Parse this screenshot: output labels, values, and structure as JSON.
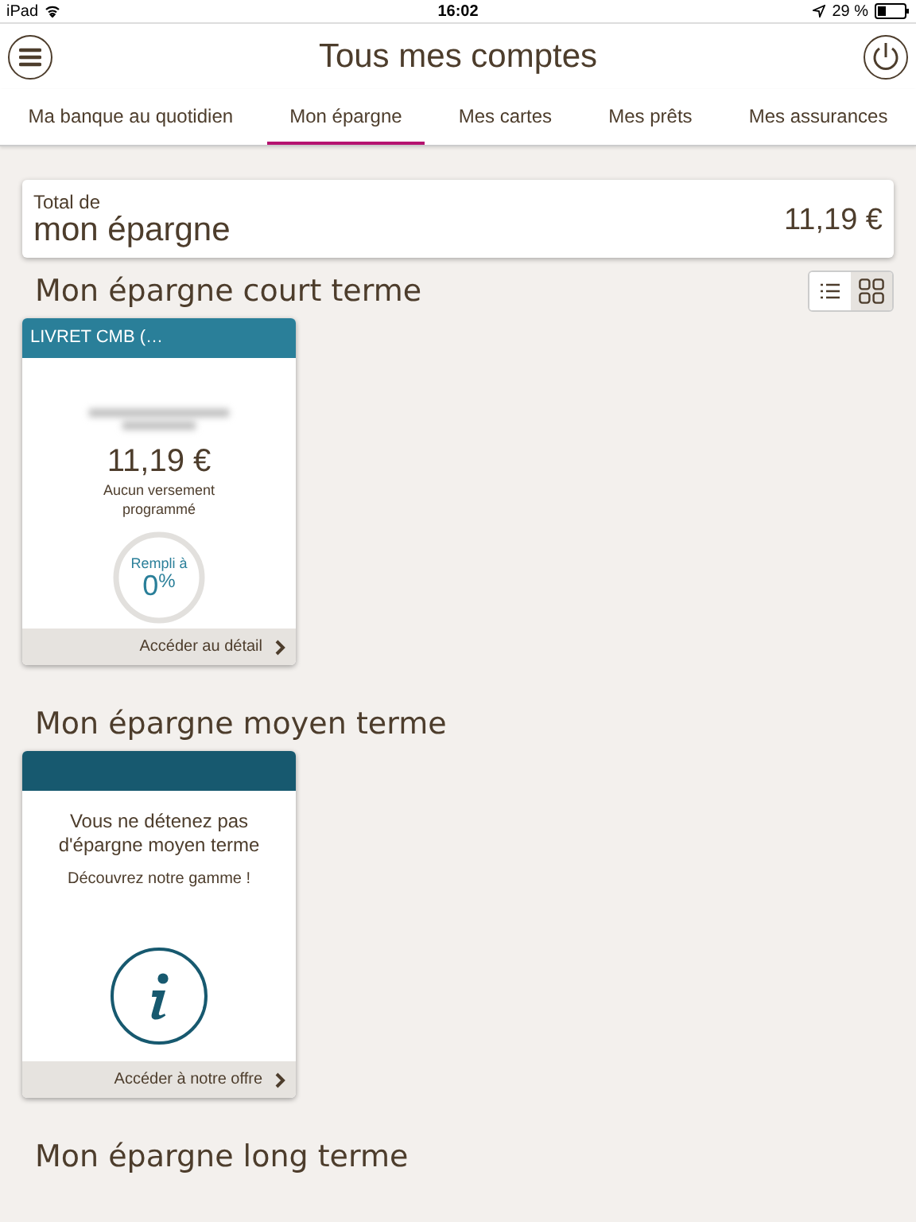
{
  "status_bar": {
    "device": "iPad",
    "time": "16:02",
    "battery": "29 %"
  },
  "header": {
    "title": "Tous mes comptes"
  },
  "tabs": [
    {
      "label": "Ma banque au quotidien",
      "selected": false
    },
    {
      "label": "Mon épargne",
      "selected": true
    },
    {
      "label": "Mes cartes",
      "selected": false
    },
    {
      "label": "Mes prêts",
      "selected": false
    },
    {
      "label": "Mes assurances",
      "selected": false
    }
  ],
  "total": {
    "label_small": "Total de",
    "label_large": "mon épargne",
    "amount": "11,19 €"
  },
  "view_toggle": [
    {
      "kind": "list",
      "selected": false
    },
    {
      "kind": "grid",
      "selected": true
    }
  ],
  "sections": [
    {
      "title": "Mon épargne court terme",
      "cards": [
        {
          "kind": "account",
          "name": "LIVRET CMB (…",
          "amount": "11,19 €",
          "note": "Aucun versement programmé",
          "gauge_label": "Rempli à",
          "gauge_value": "0",
          "gauge_unit": "%",
          "level": 0,
          "link": "Accéder au détail"
        }
      ]
    },
    {
      "title": "Mon épargne moyen terme",
      "cards": [
        {
          "kind": "empty",
          "message": "Vous ne détenez pas d'épargne moyen terme",
          "cta": "Découvrez notre gamme !",
          "link": "Accéder à notre offre"
        }
      ]
    },
    {
      "title": "Mon épargne long terme"
    }
  ]
}
